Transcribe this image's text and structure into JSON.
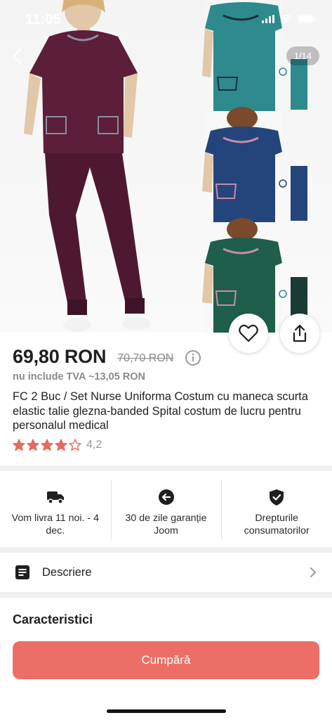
{
  "status_bar": {
    "time": "11:05"
  },
  "gallery": {
    "counter": "1/14"
  },
  "product": {
    "price": "69,80 RON",
    "old_price": "70,70 RON",
    "vat_note": "nu include TVA ~13,05 RON",
    "title": "FC 2 Buc / Set Nurse Uniforma Costum cu maneca scurta elastic talie glezna-banded Spital costum de lucru pentru personalul medical",
    "rating": "4,2",
    "rating_value": 4.2,
    "stars_filled": 4,
    "stars_total": 5
  },
  "benefits": [
    {
      "icon": "truck-icon",
      "label": "Vom livra 11 noi. - 4 dec."
    },
    {
      "icon": "return-arrow-icon",
      "label": "30 de zile garanție Joom"
    },
    {
      "icon": "shield-check-icon",
      "label": "Drepturile consumatorilor"
    }
  ],
  "description": {
    "label": "Descriere"
  },
  "characteristics": {
    "title": "Caracteristici"
  },
  "buy_button": {
    "label": "Cumpără"
  },
  "colors": {
    "accent": "#ec6f67",
    "star": "#e66a5f",
    "burgundy": "#5c1e38",
    "teal": "#2e8a8c",
    "navy": "#24447c",
    "green": "#1f5e4a"
  }
}
